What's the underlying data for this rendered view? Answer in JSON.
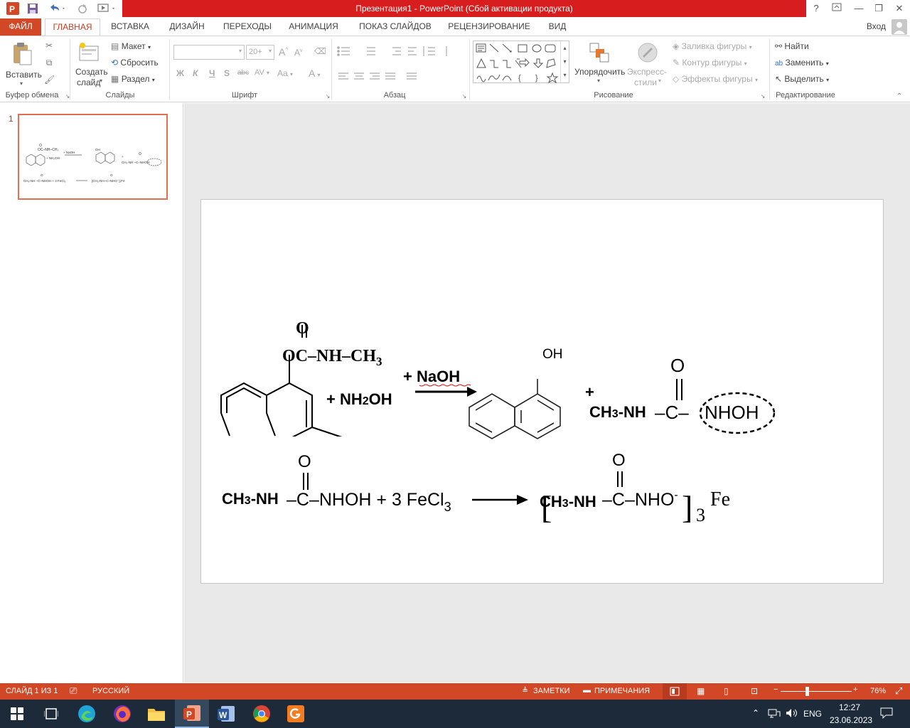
{
  "window": {
    "title": "Презентация1 -  PowerPoint (Сбой активации продукта)",
    "help": "?",
    "controls": {
      "minimize": "—",
      "restore": "❐",
      "close": "✕"
    }
  },
  "tabs": [
    "ФАЙЛ",
    "ГЛАВНАЯ",
    "ВСТАВКА",
    "ДИЗАЙН",
    "ПЕРЕХОДЫ",
    "АНИМАЦИЯ",
    "ПОКАЗ СЛАЙДОВ",
    "РЕЦЕНЗИРОВАНИЕ",
    "ВИД"
  ],
  "signin": "Вход",
  "ribbon": {
    "clipboard": {
      "label": "Буфер обмена",
      "paste": "Вставить"
    },
    "slides": {
      "label": "Слайды",
      "new_slide_1": "Создать",
      "new_slide_2": "слайд",
      "layout": "Макет",
      "reset": "Сбросить",
      "section": "Раздел"
    },
    "font": {
      "label": "Шрифт",
      "size": "20+",
      "bold": "Ж",
      "italic": "К",
      "underline": "Ч",
      "shadow": "S",
      "strike": "abc",
      "spacing": "AV",
      "case": "Aa",
      "color": "A",
      "grow": "A",
      "shrink": "A"
    },
    "paragraph": {
      "label": "Абзац"
    },
    "drawing": {
      "label": "Рисование",
      "arrange": "Упорядочить",
      "quick_styles_1": "Экспресс-",
      "quick_styles_2": "стили",
      "fill": "Заливка фигуры",
      "outline": "Контур фигуры",
      "effects": "Эффекты фигуры"
    },
    "editing": {
      "label": "Редактирование",
      "find": "Найти",
      "replace": "Заменить",
      "select": "Выделить"
    }
  },
  "thumbnail": {
    "number": "1"
  },
  "slide": {
    "r1": {
      "o_top": "O",
      "ester": "OC–NH–CH",
      "ester_sub": "3",
      "reagent_a": "+ NH",
      "reagent_a_sub": "2",
      "reagent_a_end": "OH",
      "reagent_b": "+ NaOH",
      "oh": "OH",
      "plus": "+",
      "o_top_right": "O",
      "ch3nh": "CH",
      "ch3nh_sub": "3",
      "ch3nh_end": "-NH",
      "carbonyl": "–C–",
      "nhoh": "NHOH"
    },
    "r2": {
      "ch3nh": "CH",
      "ch3nh_sub": "3",
      "ch3nh_end": "-NH",
      "o_a": "O",
      "part_a": "–C–NHOH + 3 FeCl",
      "part_a_sub": "3",
      "o_b": "O",
      "bracket_l": "[",
      "ch3nh_b": "CH",
      "ch3nh_b_sub": "3",
      "ch3nh_b_end": "-NH",
      "part_b": "–C–NHO",
      "charge": "-",
      "bracket_r": "]",
      "count": "3",
      "fe": "Fe"
    }
  },
  "status": {
    "slide": "СЛАЙД 1 ИЗ 1",
    "language": "РУССКИЙ",
    "notes": "ЗАМЕТКИ",
    "comments": "ПРИМЕЧАНИЯ",
    "zoom": "76%"
  },
  "taskbar": {
    "lang": "ENG",
    "time": "12:27",
    "date": "23.06.2023"
  }
}
